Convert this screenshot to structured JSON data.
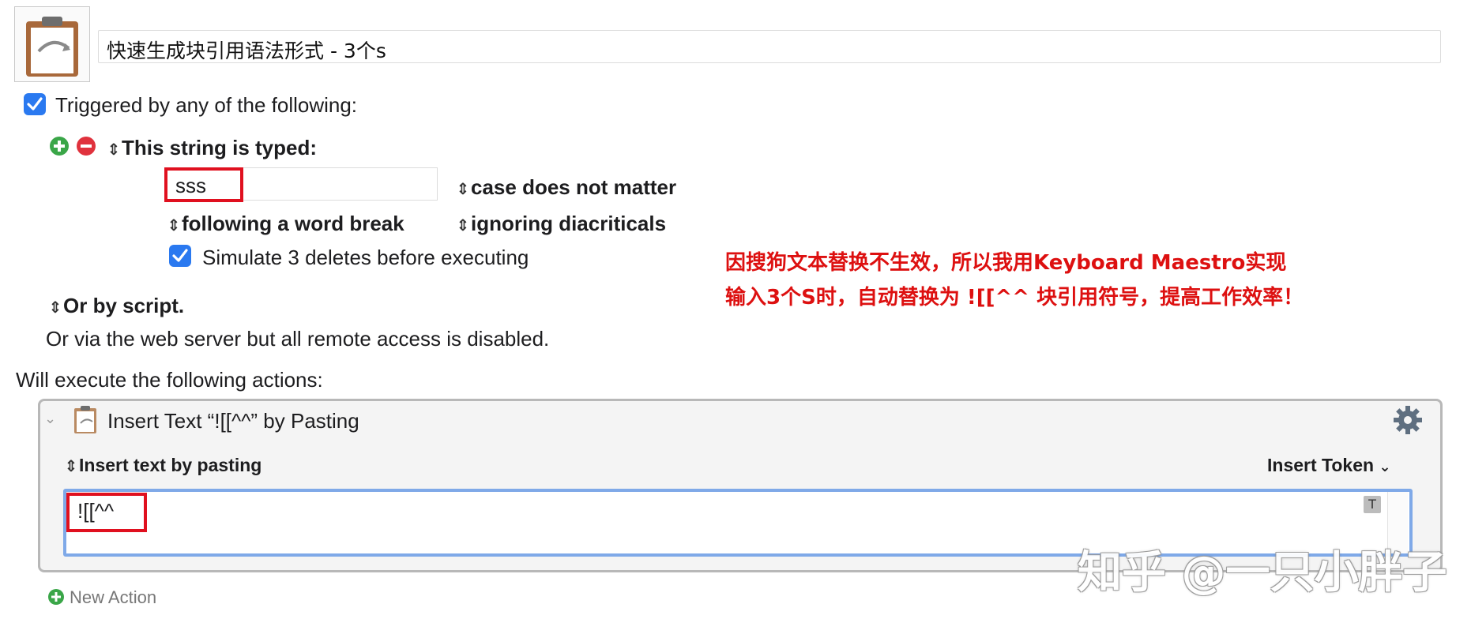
{
  "macro": {
    "title": "快速生成块引用语法形式 - 3个s",
    "icon": "clipboard-icon"
  },
  "triggers": {
    "enabled_label": "Triggered by any of the following:",
    "string_trigger_label": "This string is typed:",
    "typed_string": "sss",
    "case_option": "case does not matter",
    "word_break_option": "following a word break",
    "diacritics_option": "ignoring diacriticals",
    "simulate_label": "Simulate 3 deletes before executing",
    "script_label": "Or by script.",
    "web_server_note": "Or via the web server but all remote access is disabled."
  },
  "annotation": {
    "line1": "因搜狗文本替换不生效，所以我用Keyboard Maestro实现",
    "line2": "输入3个S时，自动替换为 ![[^^ 块引用符号，提高工作效率！"
  },
  "actions": {
    "header": "Will execute the following actions:",
    "action_title": "Insert Text “![[^^” by Pasting",
    "mode_label": "Insert text by pasting",
    "insert_token_label": "Insert Token",
    "text_value": "![[^^",
    "t_badge": "T",
    "new_action_label": "New Action"
  },
  "watermark": "知乎 @一只小胖子",
  "colors": {
    "checkbox_blue": "#2a79f0",
    "add_green": "#3aa648",
    "remove_red": "#e0323d",
    "annotation_red": "#dd1010",
    "focus_blue": "#7fa9e8"
  }
}
